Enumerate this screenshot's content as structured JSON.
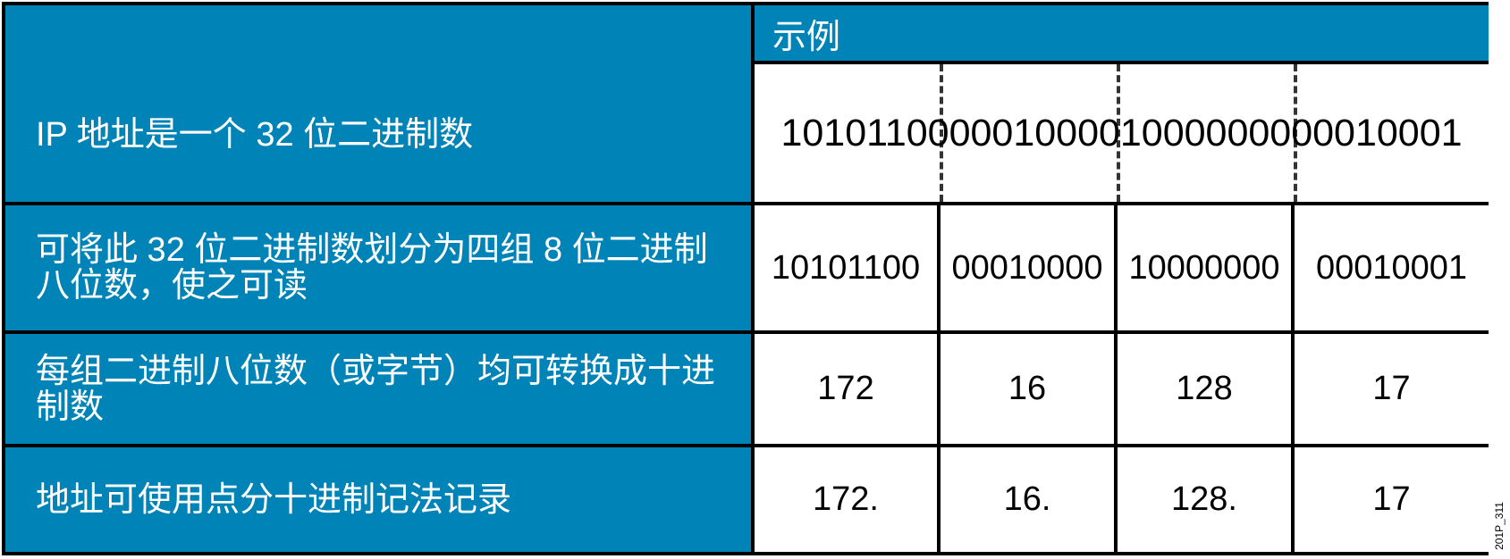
{
  "header": {
    "example_label": "示例"
  },
  "rows": [
    {
      "label": "IP 地址是一个 32 位二进制数",
      "binary": "10101100000100001000000000010001"
    },
    {
      "label": "可将此 32 位二进制数划分为四组 8 位二进制八位数，使之可读",
      "values": [
        "10101100",
        "00010000",
        "10000000",
        "00010001"
      ]
    },
    {
      "label": "每组二进制八位数（或字节）均可转换成十进制数",
      "values": [
        "172",
        "16",
        "128",
        "17"
      ]
    },
    {
      "label": "地址可使用点分十进制记法记录",
      "values": [
        "172.",
        "16.",
        "128.",
        "17"
      ]
    }
  ],
  "figure_id": "201P_311",
  "colors": {
    "blue": "#0083b6",
    "border": "#000000"
  }
}
